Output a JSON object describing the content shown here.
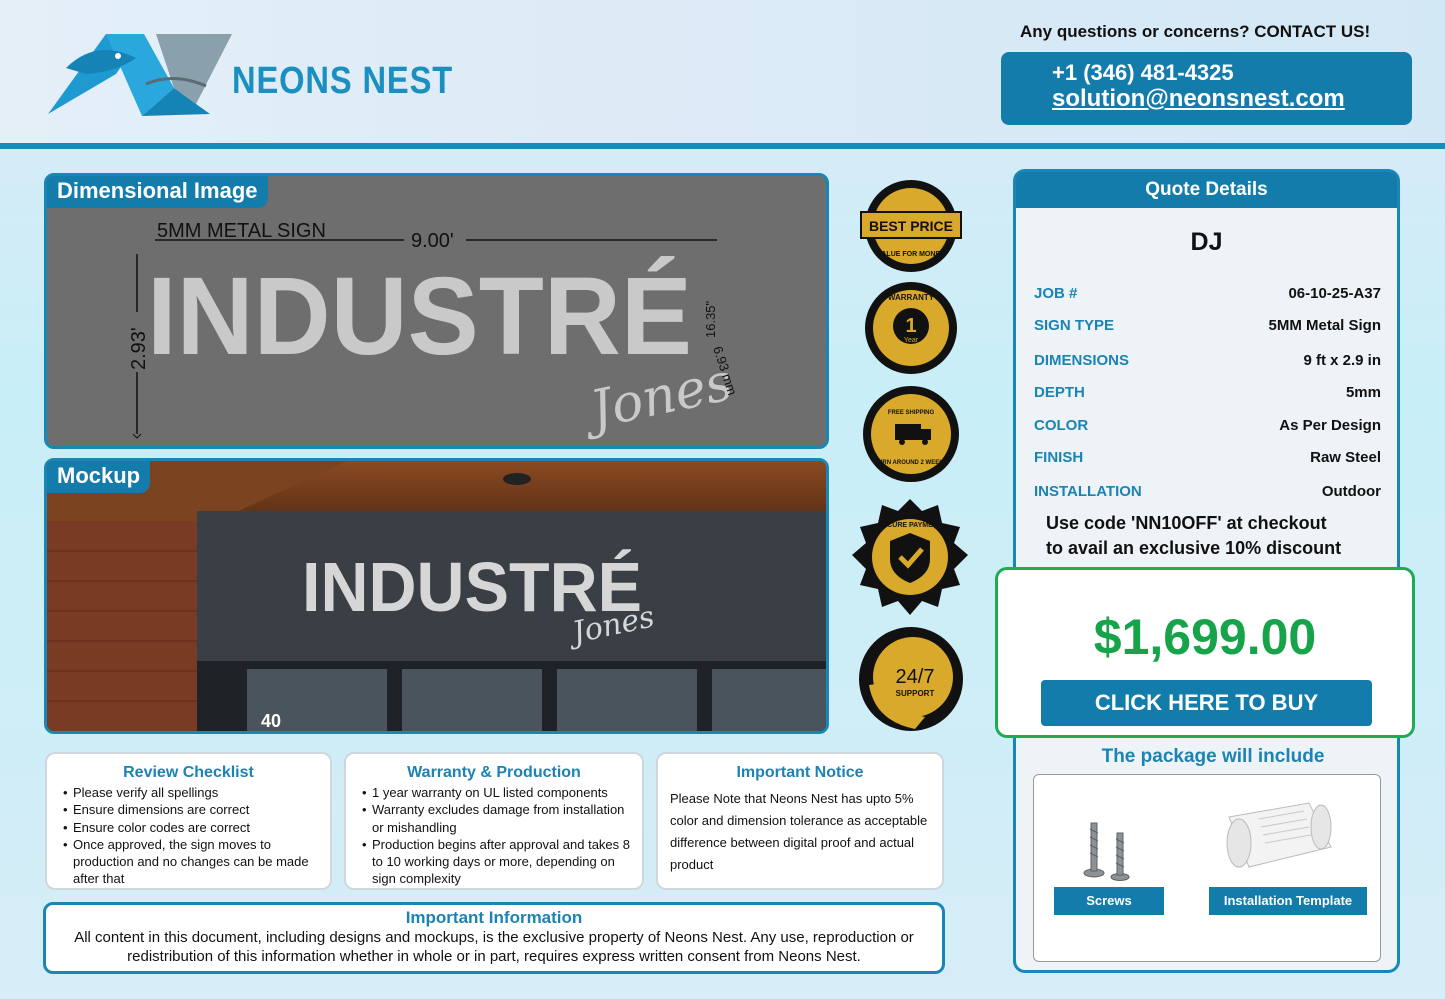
{
  "brand": {
    "name": "NEONS NEST"
  },
  "contact": {
    "heading": "Any questions or concerns? CONTACT US!",
    "phone": "+1 (346) 481-4325",
    "email": "solution@neonsnest.com"
  },
  "dimensional": {
    "tag": "Dimensional Image",
    "sign_label": "5MM METAL SIGN",
    "width": "9.00'",
    "height": "2.93'",
    "dim_right_1": "16.35\"",
    "dim_right_2": "6.93 mm",
    "main_text": "INDUSTRÉ",
    "script_text": "Jones"
  },
  "mockup": {
    "tag": "Mockup",
    "main_text": "INDUSTRÉ",
    "script_text": "Jones",
    "address": "40"
  },
  "badges": [
    {
      "name": "best-price-badge",
      "line1": "BEST PRICE",
      "line2": "VALUE FOR MONEY"
    },
    {
      "name": "warranty-badge",
      "line1": "WARRANTY",
      "number": "1",
      "unit": "Year"
    },
    {
      "name": "free-shipping-badge",
      "line1": "FREE SHIPPING",
      "line2": "TURN AROUND 2 WEEKS"
    },
    {
      "name": "secure-payment-badge",
      "line1": "SECURE PAYMENT"
    },
    {
      "name": "support-badge",
      "line1": "24/7",
      "line2": "SUPPORT"
    }
  ],
  "quote": {
    "title": "Quote Details",
    "customer": "DJ",
    "rows": [
      {
        "key": "JOB #",
        "value": "06-10-25-A37"
      },
      {
        "key": "SIGN TYPE",
        "value": "5MM Metal Sign"
      },
      {
        "key": "DIMENSIONS",
        "value": "9 ft x 2.9 in"
      },
      {
        "key": "DEPTH",
        "value": "5mm"
      },
      {
        "key": "COLOR",
        "value": "As Per Design"
      },
      {
        "key": "FINISH",
        "value": "Raw Steel"
      },
      {
        "key": "INSTALLATION",
        "value": "Outdoor"
      }
    ],
    "promo_line1": "Use code 'NN10OFF' at checkout",
    "promo_line2": "to avail an exclusive 10% discount",
    "price": "$1,699.00",
    "buy_label": "CLICK HERE TO BUY",
    "package_title": "The package will include",
    "package_items": [
      "Screws",
      "Installation Template"
    ]
  },
  "review": {
    "title": "Review Checklist",
    "items": [
      "Please verify all spellings",
      "Ensure dimensions are correct",
      "Ensure color codes are correct",
      "Once approved, the sign moves to production and no changes can be made after that"
    ]
  },
  "warranty": {
    "title": "Warranty & Production",
    "items": [
      "1 year warranty on UL listed components",
      "Warranty excludes damage from installation or mishandling",
      "Production begins after approval and takes 8 to 10 working days or more, depending on sign complexity"
    ]
  },
  "notice": {
    "title": "Important Notice",
    "text": "Please Note that Neons Nest has upto 5% color and dimension tolerance as acceptable difference between digital proof and actual product"
  },
  "info": {
    "title": "Important Information",
    "text": "All content in this document, including designs and mockups, is the exclusive property of Neons Nest. Any use, reproduction or redistribution of this information whether in whole or in part, requires express written consent from Neons Nest."
  }
}
